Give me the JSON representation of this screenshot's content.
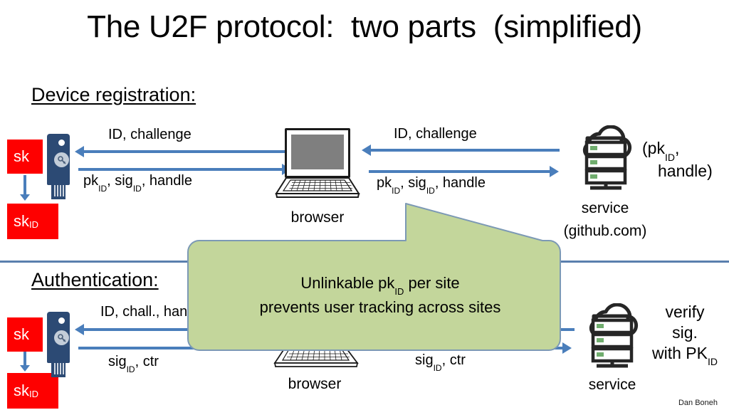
{
  "slide": {
    "title": "The U2F protocol:  two parts  (simplified)",
    "footer": "Dan Boneh"
  },
  "registration": {
    "heading": "Device registration:",
    "sk_box": {
      "label": "sk"
    },
    "sk_id_box": {
      "label": "sk",
      "sub": "ID"
    },
    "msg_down": {
      "text": "ID,  challenge"
    },
    "msg_up": {
      "text_a": "pk",
      "sub_a": "ID",
      "text_b": ",  sig",
      "sub_b": "ID",
      "text_c": ",  handle"
    },
    "browser_caption": "browser",
    "service_msg_down": {
      "text": "ID,  challenge"
    },
    "service_msg_up": {
      "text_a": "pk",
      "sub_a": "ID",
      "text_b": ",  sig",
      "sub_b": "ID",
      "text_c": ",  handle"
    },
    "service_label": "service",
    "service_domain": "(github.com)",
    "stored_note_line1_a": "(pk",
    "stored_note_line1_sub": "ID",
    "stored_note_line1_b": ",",
    "stored_note_line2": "handle)"
  },
  "authentication": {
    "heading": "Authentication:",
    "sk_box": {
      "label": "sk"
    },
    "sk_id_box": {
      "label": "sk",
      "sub": "ID"
    },
    "msg_down": {
      "text": "ID,  chall.,  handle"
    },
    "msg_up": {
      "text_a": "sig",
      "sub_a": "ID",
      "text_b": ",  ctr"
    },
    "browser_caption": "browser",
    "service_msg_up": {
      "text_a": "sig",
      "sub_a": "ID",
      "text_b": ",  ctr"
    },
    "service_label": "service",
    "verify_line1": "verify",
    "verify_line2": "sig.",
    "verify_line3_a": "with PK",
    "verify_line3_sub": "ID"
  },
  "callout": {
    "line1_a": "Unlinkable  pk",
    "line1_sub": "ID",
    "line1_b": " per site",
    "line2": "prevents user tracking across sites"
  },
  "colors": {
    "red_box": "#FE0000",
    "arrow_blue": "#4a7ebb",
    "divider_blue": "#5a7fae",
    "callout_fill": "#c3d69b",
    "callout_stroke": "#7c99b5",
    "yubikey_body": "#2c4a74",
    "laptop_screen": "#7f7f7f",
    "server_led": "#70ad6e"
  },
  "icons": {
    "yubikey": "security-key-icon",
    "laptop": "laptop-icon",
    "cloud_server": "cloud-server-icon",
    "key_glyph": "key-icon"
  }
}
